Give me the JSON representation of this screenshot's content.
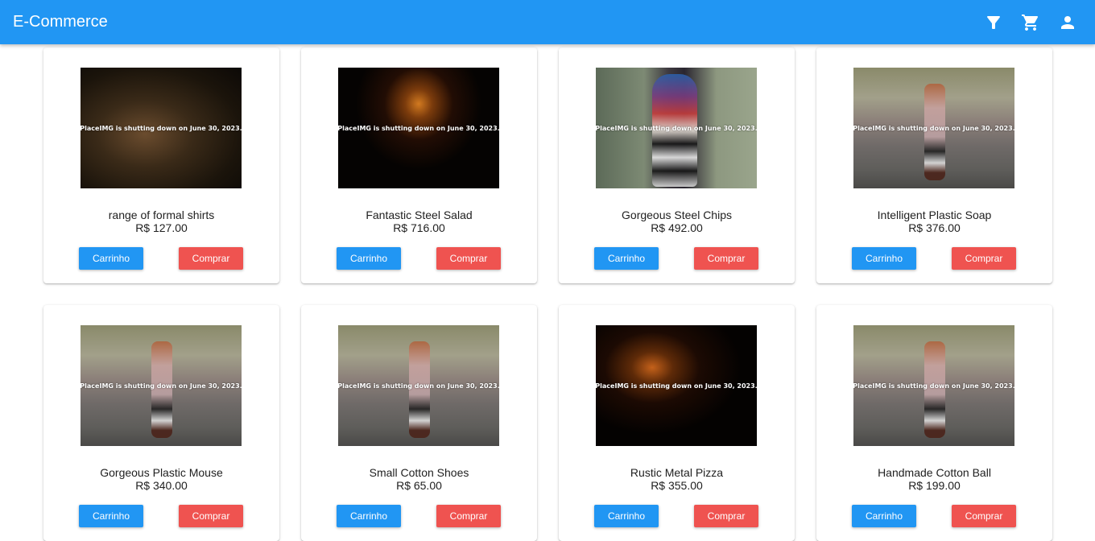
{
  "appbar": {
    "title": "E-Commerce",
    "icons": [
      "filter-icon",
      "cart-icon",
      "account-icon"
    ]
  },
  "colors": {
    "appbar": "#2196f3",
    "cart_button": "#2196f3",
    "buy_button": "#ef5350"
  },
  "products": [
    {
      "name": "range of formal shirts",
      "price": "R$ 127.00",
      "image": "cave",
      "notice": "PlaceIMG is shutting down on June 30, 2023.",
      "cart_label": "Carrinho",
      "buy_label": "Comprar"
    },
    {
      "name": "Fantastic Steel Salad",
      "price": "R$ 716.00",
      "image": "road",
      "notice": "PlaceIMG is shutting down on June 30, 2023.",
      "cart_label": "Carrinho",
      "buy_label": "Comprar"
    },
    {
      "name": "Gorgeous Steel Chips",
      "price": "R$ 492.00",
      "image": "scarf",
      "notice": "PlaceIMG is shutting down on June 30, 2023.",
      "cart_label": "Carrinho",
      "buy_label": "Comprar"
    },
    {
      "name": "Intelligent Plastic Soap",
      "price": "R$ 376.00",
      "image": "woman",
      "notice": "PlaceIMG is shutting down on June 30, 2023.",
      "cart_label": "Carrinho",
      "buy_label": "Comprar"
    },
    {
      "name": "Gorgeous Plastic Mouse",
      "price": "R$ 340.00",
      "image": "woman",
      "notice": "PlaceIMG is shutting down on June 30, 2023.",
      "cart_label": "Carrinho",
      "buy_label": "Comprar"
    },
    {
      "name": "Small Cotton Shoes",
      "price": "R$ 65.00",
      "image": "woman",
      "notice": "PlaceIMG is shutting down on June 30, 2023.",
      "cart_label": "Carrinho",
      "buy_label": "Comprar"
    },
    {
      "name": "Rustic Metal Pizza",
      "price": "R$ 355.00",
      "image": "road2",
      "notice": "PlaceIMG is shutting down on June 30, 2023.",
      "cart_label": "Carrinho",
      "buy_label": "Comprar"
    },
    {
      "name": "Handmade Cotton Ball",
      "price": "R$ 199.00",
      "image": "woman",
      "notice": "PlaceIMG is shutting down on June 30, 2023.",
      "cart_label": "Carrinho",
      "buy_label": "Comprar"
    }
  ]
}
